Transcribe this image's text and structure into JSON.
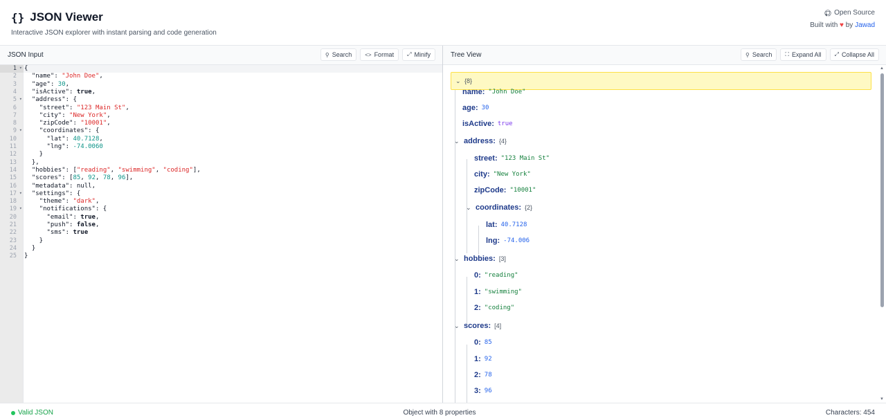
{
  "header": {
    "icon_text": "{}",
    "title": "JSON Viewer",
    "subtitle": "Interactive JSON explorer with instant parsing and code generation",
    "open_source": "Open Source",
    "built_with": "Built with",
    "by": "by",
    "author": "Jawad"
  },
  "left_pane": {
    "title": "JSON Input",
    "buttons": {
      "search": "Search",
      "format": "Format",
      "minify": "Minify"
    }
  },
  "right_pane": {
    "title": "Tree View",
    "buttons": {
      "search": "Search",
      "expand": "Expand All",
      "collapse": "Collapse All"
    }
  },
  "editor": {
    "lines": [
      "{",
      "  \"name\": \"John Doe\",",
      "  \"age\": 30,",
      "  \"isActive\": true,",
      "  \"address\": {",
      "    \"street\": \"123 Main St\",",
      "    \"city\": \"New York\",",
      "    \"zipCode\": \"10001\",",
      "    \"coordinates\": {",
      "      \"lat\": 40.7128,",
      "      \"lng\": -74.0060",
      "    }",
      "  },",
      "  \"hobbies\": [\"reading\", \"swimming\", \"coding\"],",
      "  \"scores\": [85, 92, 78, 96],",
      "  \"metadata\": null,",
      "  \"settings\": {",
      "    \"theme\": \"dark\",",
      "    \"notifications\": {",
      "      \"email\": true,",
      "      \"push\": false,",
      "      \"sms\": true",
      "    }",
      "  }",
      "}"
    ]
  },
  "tree": {
    "root_count": "{8}",
    "rows": [
      {
        "key": "name:",
        "value": "\"John Doe\"",
        "vtype": "str"
      },
      {
        "key": "age:",
        "value": "30",
        "vtype": "num"
      },
      {
        "key": "isActive:",
        "value": "true",
        "vtype": "bool"
      },
      {
        "key": "address:",
        "count": "{4}"
      },
      {
        "key": "street:",
        "value": "\"123 Main St\"",
        "vtype": "str"
      },
      {
        "key": "city:",
        "value": "\"New York\"",
        "vtype": "str"
      },
      {
        "key": "zipCode:",
        "value": "\"10001\"",
        "vtype": "str"
      },
      {
        "key": "coordinates:",
        "count": "{2}"
      },
      {
        "key": "lat:",
        "value": "40.7128",
        "vtype": "num"
      },
      {
        "key": "lng:",
        "value": "-74.006",
        "vtype": "num"
      },
      {
        "key": "hobbies:",
        "count": "[3]"
      },
      {
        "key": "0:",
        "value": "\"reading\"",
        "vtype": "str"
      },
      {
        "key": "1:",
        "value": "\"swimming\"",
        "vtype": "str"
      },
      {
        "key": "2:",
        "value": "\"coding\"",
        "vtype": "str"
      },
      {
        "key": "scores:",
        "count": "[4]"
      },
      {
        "key": "0:",
        "value": "85",
        "vtype": "num"
      },
      {
        "key": "1:",
        "value": "92",
        "vtype": "num"
      },
      {
        "key": "2:",
        "value": "78",
        "vtype": "num"
      },
      {
        "key": "3:",
        "value": "96",
        "vtype": "num"
      }
    ]
  },
  "footer": {
    "status": "Valid JSON",
    "summary": "Object with 8 properties",
    "characters": "Characters: 454"
  },
  "colors": {
    "accent": "#2563eb",
    "valid": "#22c55e",
    "highlight": "#fef9c3"
  }
}
